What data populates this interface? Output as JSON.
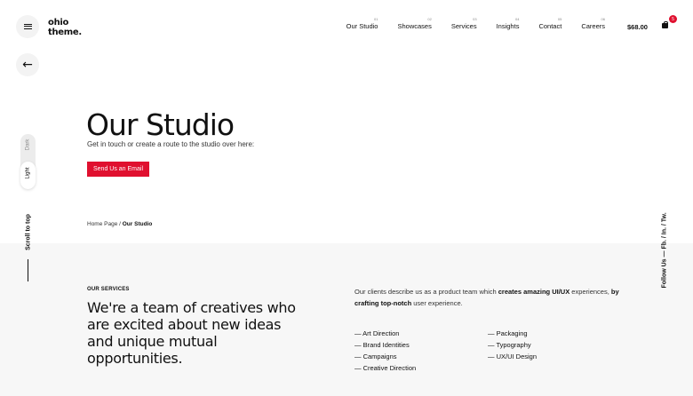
{
  "brand": {
    "line1": "ohio",
    "line2": "theme."
  },
  "nav": [
    {
      "num": "01",
      "label": "Our Studio"
    },
    {
      "num": "02",
      "label": "Showcases"
    },
    {
      "num": "03",
      "label": "Services"
    },
    {
      "num": "04",
      "label": "Insights"
    },
    {
      "num": "05",
      "label": "Contact"
    },
    {
      "num": "06",
      "label": "Careers"
    }
  ],
  "cart": {
    "price": "$68.00",
    "count": "5"
  },
  "theme": {
    "dark": "Dark",
    "light": "Light"
  },
  "side": {
    "scroll_top": "Scroll to top",
    "follow": "Follow Us — Fb. / In. / Tw."
  },
  "hero": {
    "title": "Our Studio",
    "subtitle": "Get in touch or create a route to the studio over here:",
    "cta": "Send Us an Email"
  },
  "breadcrumb": {
    "home": "Home Page",
    "sep": " / ",
    "current": "Our Studio"
  },
  "services": {
    "label": "OUR SERVICES",
    "headline": "We're a team of creatives who are excited about new ideas and unique mutual opportunities.",
    "desc_1": "Our clients describe us as a product team which ",
    "desc_b1": "creates amazing UI/UX",
    "desc_2": " experiences, ",
    "desc_b2": "by crafting top-notch",
    "desc_3": " user experience.",
    "col1": [
      "— Art Direction",
      "— Brand Identities",
      "— Campaigns",
      "— Creative Direction"
    ],
    "col2": [
      "— Packaging",
      "— Typography",
      "— UX/UI Design"
    ]
  },
  "colors": {
    "accent": "#e0102f",
    "section_bg": "#f7f7f7"
  },
  "icons": [
    "hamburger-icon",
    "arrow-left-icon",
    "shopping-bag-icon"
  ]
}
